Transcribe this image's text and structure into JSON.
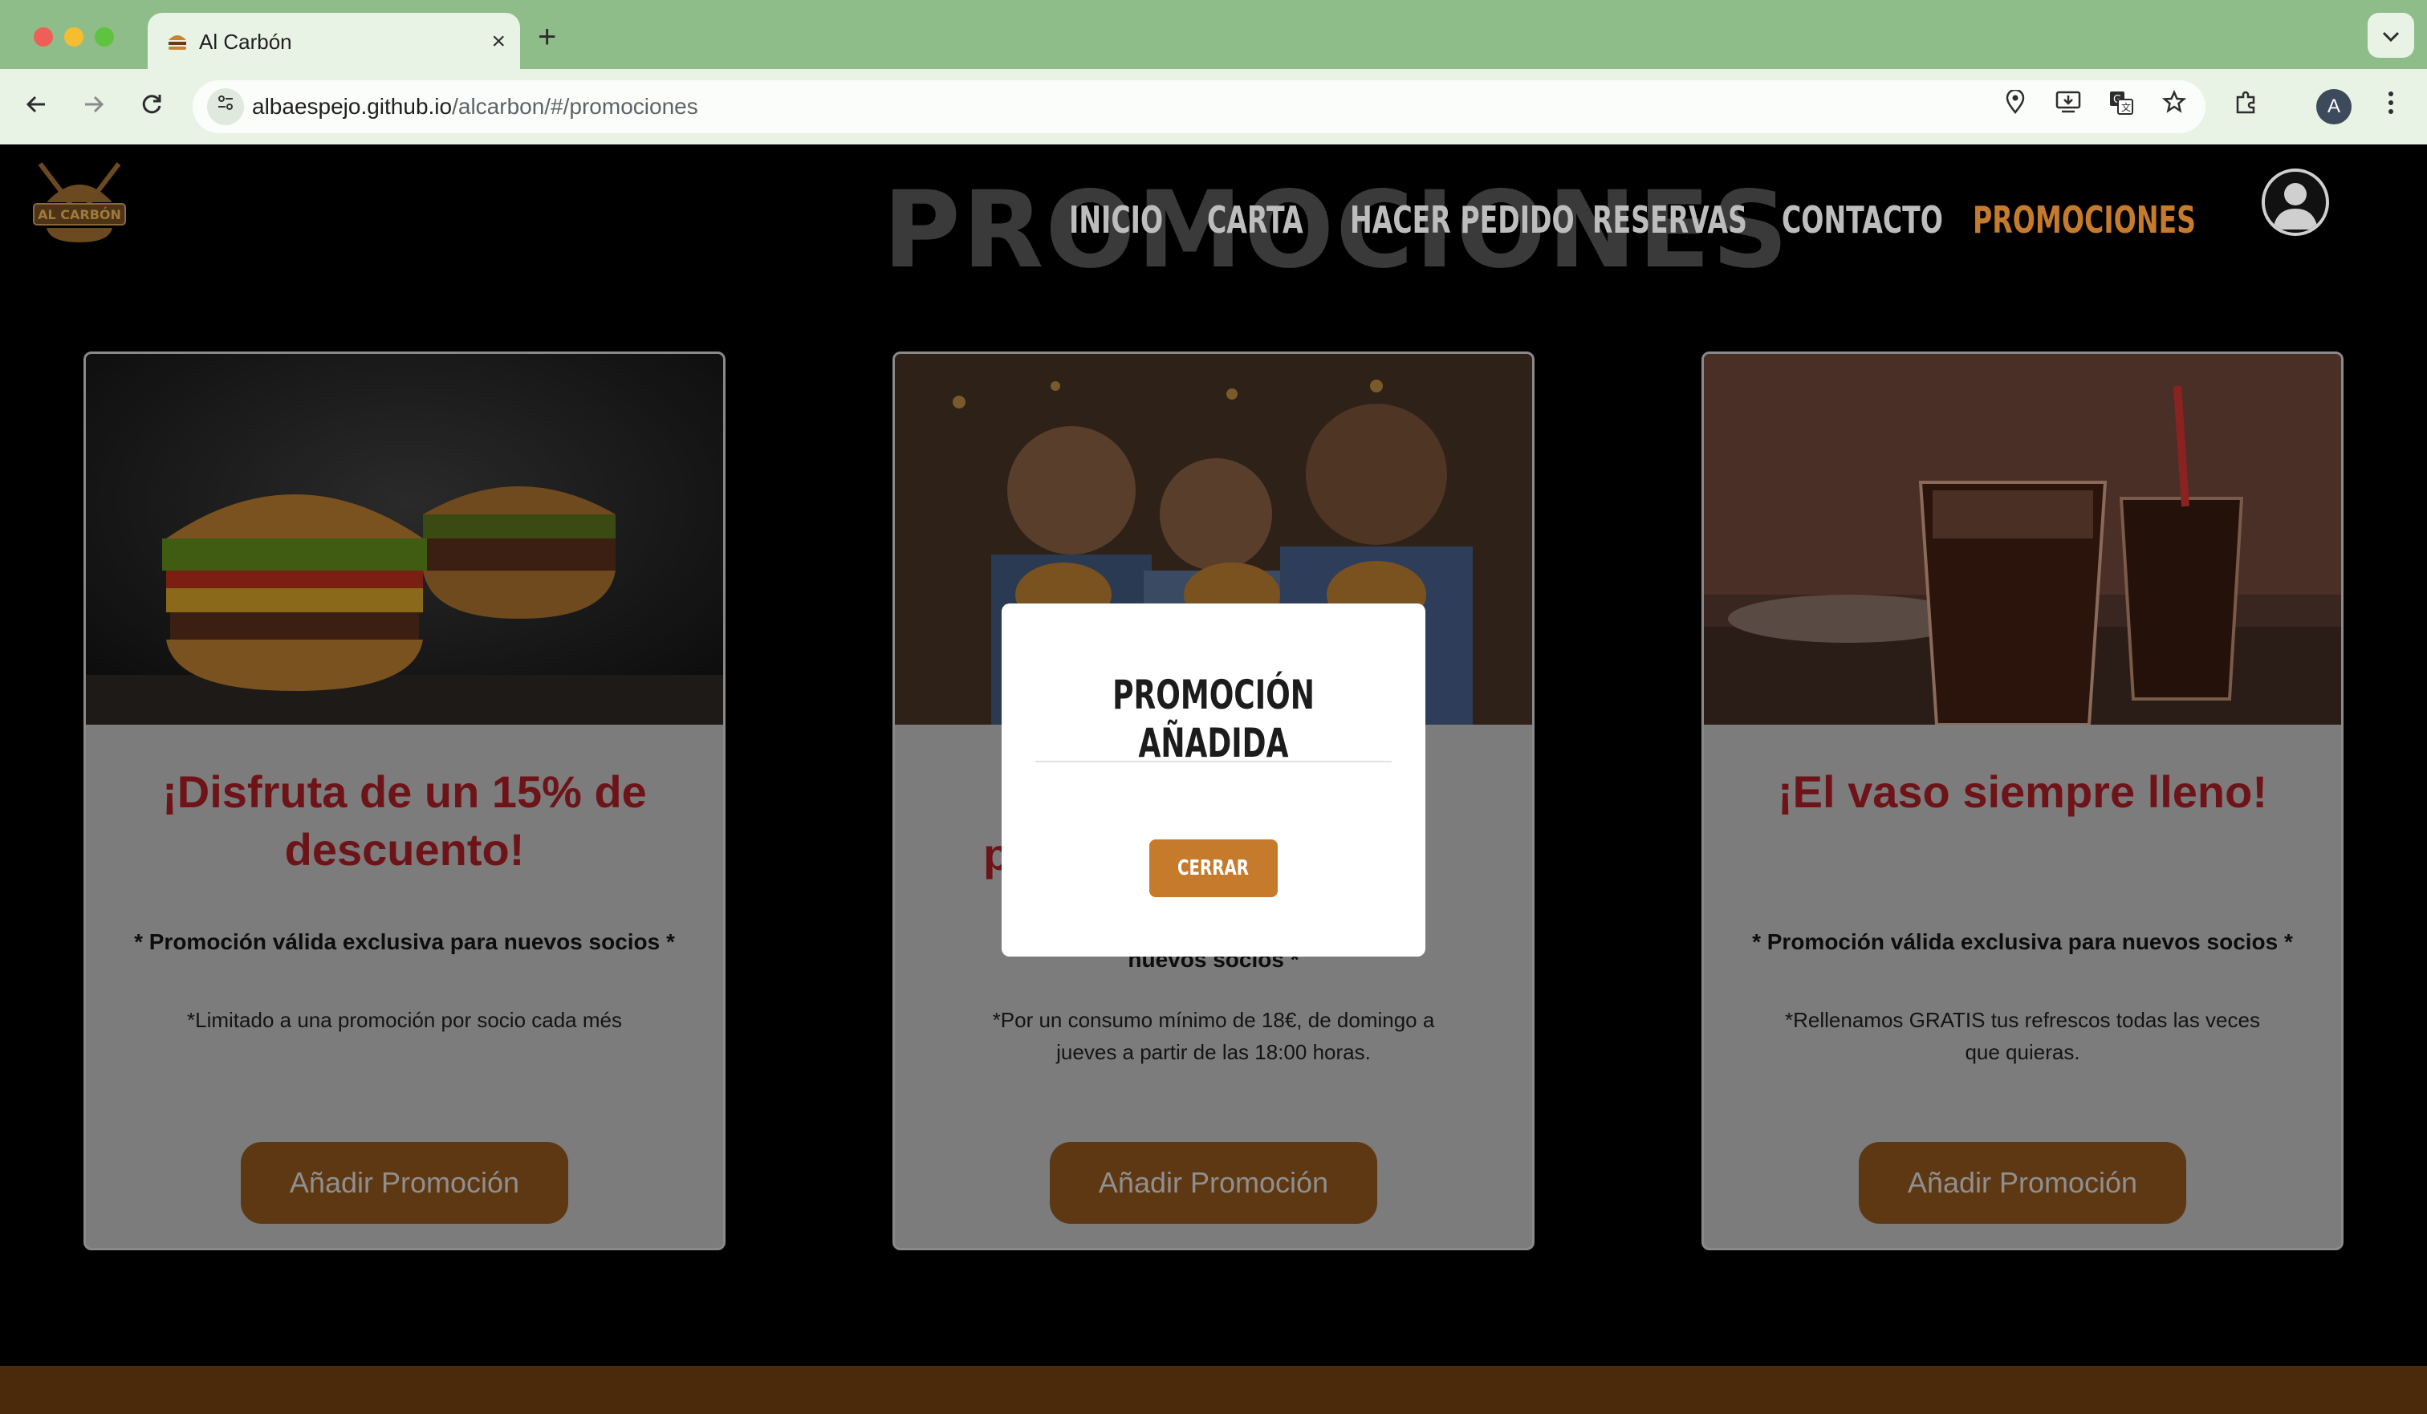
{
  "browser": {
    "tab_title": "Al Carbón",
    "tab_close": "×",
    "new_tab": "+",
    "url_host": "albaespejo.github.io",
    "url_path": "/alcarbon/#/promociones",
    "profile_initial": "A"
  },
  "site": {
    "bg_title": "PROMOCIONES",
    "nav": {
      "inicio": "INICIO",
      "carta": "CARTA",
      "hacer_pedido": "HACER PEDIDO",
      "reservas": "RESERVAS",
      "contacto": "CONTACTO",
      "promociones": "PROMOCIONES"
    },
    "logo_text": "AL CARBÓN"
  },
  "cards": [
    {
      "title": "¡Disfruta de un 15% de descuento!",
      "note": "* Promoción válida exclusiva para nuevos socios *",
      "desc": "*Limitado a una promoción por socio cada més",
      "button": "Añadir Promoción"
    },
    {
      "title": "p",
      "note": "nuevos socios *",
      "desc": "*Por un consumo mínimo de 18€, de domingo a jueves a partir de las 18:00 horas.",
      "button": "Añadir Promoción"
    },
    {
      "title": "¡El vaso siempre lleno!",
      "note": "* Promoción válida exclusiva para nuevos socios *",
      "desc": "*Rellenamos GRATIS tus refrescos todas las veces que quieras.",
      "button": "Añadir Promoción"
    }
  ],
  "modal": {
    "title": "PROMOCIÓN AÑADIDA",
    "close_button": "CERRAR"
  },
  "colors": {
    "accent": "#c67a2c",
    "title_red": "#9d1c24",
    "browser_green": "#8fbd8a"
  }
}
